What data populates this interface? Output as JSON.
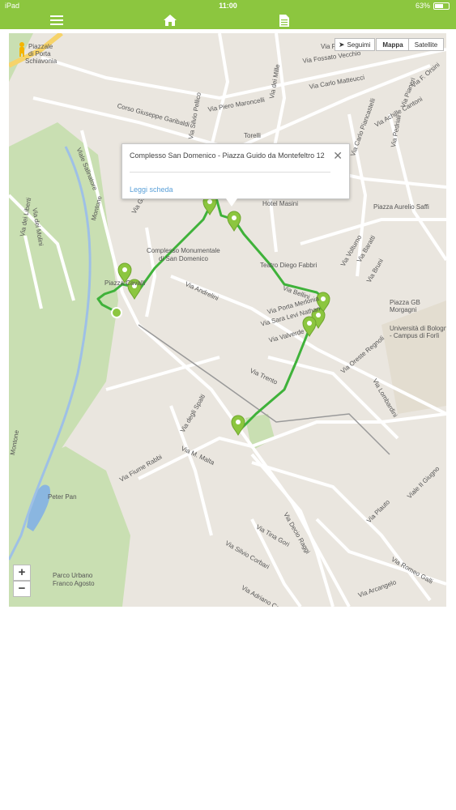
{
  "status": {
    "device": "iPad",
    "time": "11:00",
    "battery": "63%",
    "battery_level": 0.63
  },
  "nav": {
    "menu_icon": "hamburger-icon",
    "home_icon": "home-icon",
    "doc_icon": "document-icon"
  },
  "map": {
    "controls": {
      "follow": "Seguimi",
      "map": "Mappa",
      "satellite": "Satellite"
    },
    "popup": {
      "title": "Complesso San Domenico - Piazza Guido da Montefeltro 12",
      "link": "Leggi scheda"
    },
    "zoom": {
      "in": "+",
      "out": "−"
    },
    "labels": {
      "l1": "Piazzale",
      "l2": "di Porta",
      "l3": "Schiavonia",
      "l4": "Via Paradiso",
      "l5": "Via Fossato Vecchio",
      "l6": "Via Carlo Matteucci",
      "l7": "Via F. Orsini",
      "l8": "Via Achille Cantoni",
      "l9": "Via Piero Maroncelli",
      "l10": "Corso Giuseppe Garibaldi",
      "l11": "Viale Salinatore",
      "l12": "Hotel Masini",
      "l13": "Piazza Aurelio Saffi",
      "l14": "Complesso Monumentale",
      "l15": "di San Domenico",
      "l16": "Teatro Diego Fabbri",
      "l17": "Via Andrelini",
      "l18": "Via Porta Merlonia",
      "l19": "Via Sara Levi Nathan",
      "l20": "Via Valverde",
      "l21": "Piazza GB",
      "l22": "Morgagni",
      "l23": "Università di Bologna",
      "l24": "- Campus di Forlì",
      "l25": "Via Oreste Regnoli",
      "l26": "Via Trento",
      "l27": "Via dei Molini",
      "l28": "Via dei Liberti",
      "l29": "Montone",
      "l30": "Via degli Spalti",
      "l31": "Via M. Malta",
      "l32": "Via Fiume Rabbi",
      "l33": "Peter Pan",
      "l34": "Parco Urbano",
      "l35": "Franco Agosto",
      "l36": "Via Decio Raggi",
      "l37": "Via Tina Gori",
      "l38": "Via Silvio Corbari",
      "l39": "Via Adriano Casadei",
      "l40": "Via Plauto",
      "l41": "Viale II Giugno",
      "l42": "Via Romeo Galli",
      "l43": "Via Arcangelo",
      "l44": "Via Lombardini",
      "l45": "Via Volturno",
      "l46": "Via Baratti",
      "l47": "Via Bruni",
      "l48": "Via Silvio Pellico",
      "l49": "Via dei Mille",
      "l50": "Via Giovanni",
      "l51": "Via Pedriali",
      "l52": "Via Carlo Piancastelli",
      "l53": "Torelli",
      "l54": "Montone",
      "l55": "Piazza Cavalli",
      "l56": "Via Pianeri",
      "l57": "Via Bellini"
    },
    "colors": {
      "route": "#3fb23a",
      "marker": "#8cc63f",
      "park": "#c9dfb2",
      "water": "#8ab6e0"
    }
  }
}
